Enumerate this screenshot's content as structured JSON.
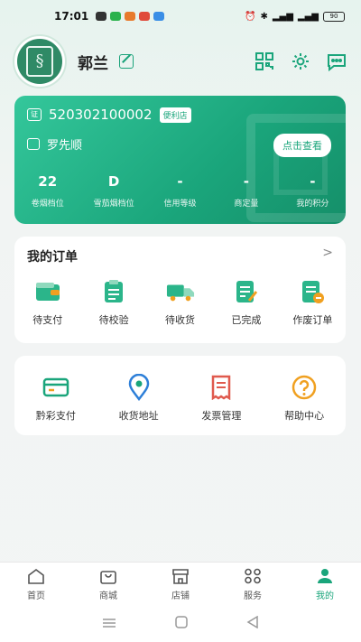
{
  "status_bar": {
    "time": "17:01",
    "battery": "90"
  },
  "profile": {
    "username": "郭兰"
  },
  "license_card": {
    "license_no": "520302100002",
    "store_type": "便利店",
    "owner_name": "罗先顺",
    "view_button": "点击查看",
    "stats": [
      {
        "value": "22",
        "label": "卷烟档位"
      },
      {
        "value": "D",
        "label": "雪茄烟档位"
      },
      {
        "value": "-",
        "label": "信用等级"
      },
      {
        "value": "-",
        "label": "商定量"
      },
      {
        "value": "-",
        "label": "我的积分"
      }
    ]
  },
  "orders": {
    "title": "我的订单",
    "more": ">",
    "items": [
      {
        "label": "待支付",
        "icon": "wallet-icon"
      },
      {
        "label": "待校验",
        "icon": "clipboard-icon"
      },
      {
        "label": "待收货",
        "icon": "truck-icon"
      },
      {
        "label": "已完成",
        "icon": "done-doc-icon"
      },
      {
        "label": "作废订单",
        "icon": "void-doc-icon"
      }
    ]
  },
  "services": {
    "items": [
      {
        "label": "黔彩支付",
        "icon": "card-icon"
      },
      {
        "label": "收货地址",
        "icon": "location-icon"
      },
      {
        "label": "发票管理",
        "icon": "invoice-icon"
      },
      {
        "label": "帮助中心",
        "icon": "help-icon"
      }
    ]
  },
  "tabs": [
    {
      "label": "首页",
      "icon": "home-icon"
    },
    {
      "label": "商城",
      "icon": "bag-icon"
    },
    {
      "label": "店铺",
      "icon": "store-icon"
    },
    {
      "label": "服务",
      "icon": "grid-icon"
    },
    {
      "label": "我的",
      "icon": "user-icon",
      "active": true
    }
  ],
  "colors": {
    "accent": "#1aa57b",
    "icon_orange": "#f0a020",
    "icon_red": "#e05a4e"
  }
}
